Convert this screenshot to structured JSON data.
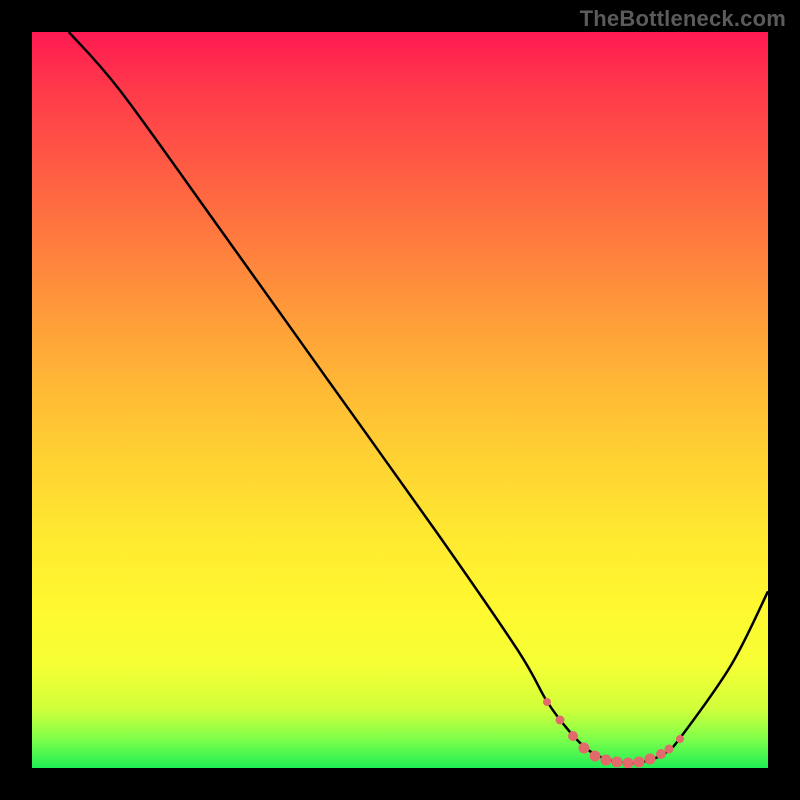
{
  "watermark": "TheBottleneck.com",
  "chart_data": {
    "type": "line",
    "title": "",
    "xlabel": "",
    "ylabel": "",
    "xlim": [
      0,
      100
    ],
    "ylim": [
      0,
      100
    ],
    "series": [
      {
        "name": "curve",
        "x": [
          5,
          12,
          25,
          40,
          55,
          66,
          70,
          73,
          75.5,
          78,
          80,
          82,
          84,
          86,
          88,
          95,
          100
        ],
        "y": [
          100,
          92,
          74,
          53,
          32,
          16,
          9,
          5,
          2.5,
          1.2,
          0.8,
          0.7,
          1.1,
          2.0,
          4.0,
          14,
          24
        ]
      }
    ],
    "markers": [
      {
        "x": 70.0,
        "y": 9.0,
        "size": 8
      },
      {
        "x": 71.8,
        "y": 6.5,
        "size": 9
      },
      {
        "x": 73.5,
        "y": 4.3,
        "size": 10
      },
      {
        "x": 75.0,
        "y": 2.7,
        "size": 11
      },
      {
        "x": 76.5,
        "y": 1.6,
        "size": 11
      },
      {
        "x": 78.0,
        "y": 1.1,
        "size": 11
      },
      {
        "x": 79.5,
        "y": 0.8,
        "size": 11
      },
      {
        "x": 81.0,
        "y": 0.7,
        "size": 11
      },
      {
        "x": 82.5,
        "y": 0.8,
        "size": 11
      },
      {
        "x": 84.0,
        "y": 1.2,
        "size": 11
      },
      {
        "x": 85.5,
        "y": 1.9,
        "size": 10
      },
      {
        "x": 86.5,
        "y": 2.6,
        "size": 9
      },
      {
        "x": 88.0,
        "y": 4.0,
        "size": 8
      }
    ],
    "colors": {
      "curve": "#000000",
      "marker": "#e36a6a",
      "gradient_top": "#ff1a52",
      "gradient_bottom": "#1fef55",
      "background": "#000000"
    }
  }
}
